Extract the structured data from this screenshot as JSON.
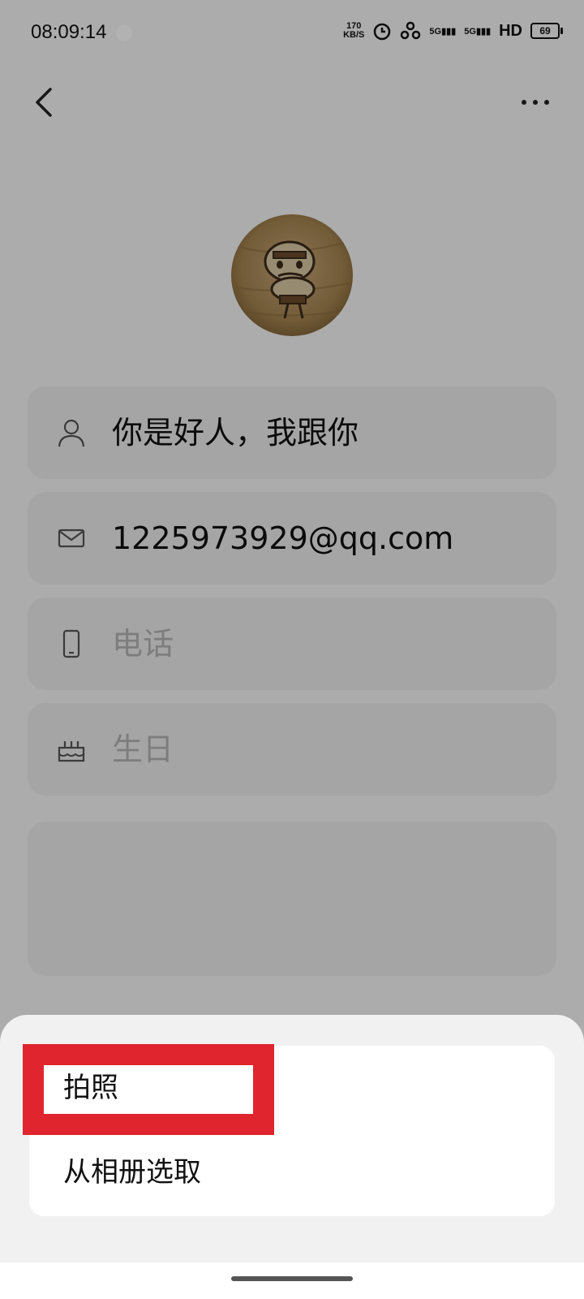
{
  "status_bar": {
    "time": "08:09:14",
    "net_speed_value": "170",
    "net_speed_unit": "KB/S",
    "signal_1": "5G",
    "signal_2": "5G",
    "hd_label": "HD",
    "battery": "69"
  },
  "contact": {
    "name": "你是好人，我跟你",
    "email": "1225973929@qq.com",
    "phone_placeholder": "电话",
    "birthday_placeholder": "生日"
  },
  "photo_sheet": {
    "options": [
      {
        "label": "拍照"
      },
      {
        "label": "从相册选取"
      }
    ]
  },
  "colors": {
    "highlight": "#e0252f",
    "overlay": "rgba(0,0,0,0.30)"
  }
}
